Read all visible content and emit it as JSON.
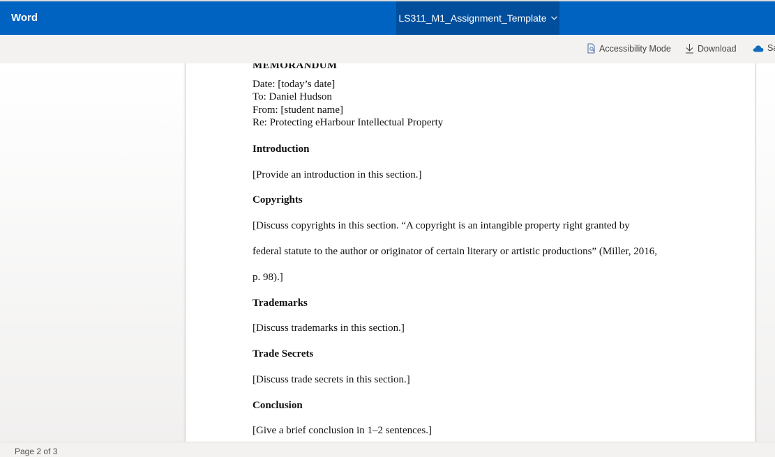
{
  "app": {
    "name": "Word",
    "document_title": "LS311_M1_Assignment_Template"
  },
  "commands": {
    "accessibility_mode": "Accessibility Mode",
    "download": "Download",
    "save": "Sa"
  },
  "document": {
    "memo_heading": "MEMORANDUM",
    "date_line": "Date: [today’s date]",
    "to_line": "To: Daniel Hudson",
    "from_line": "From: [student name]",
    "re_line": "Re: Protecting eHarbour Intellectual Property",
    "introduction_heading": "Introduction",
    "introduction_text": "[Provide an introduction in this section.]",
    "copyrights_heading": "Copyrights",
    "copyrights_text_1": "[Discuss copyrights in this section. “A copyright is an intangible property right granted by",
    "copyrights_text_2": "federal statute to the author or originator of certain literary or artistic productions” (Miller,  2016,",
    "copyrights_text_3": "p. 98).]",
    "trademarks_heading": "Trademarks",
    "trademarks_text": "[Discuss trademarks in this section.]",
    "trade_secrets_heading": "Trade Secrets",
    "trade_secrets_text": "[Discuss trade secrets in this section.]",
    "conclusion_heading": "Conclusion",
    "conclusion_text": "[Give a brief conclusion in 1–2 sentences.]"
  },
  "status": {
    "page_indicator": "Page 2 of 3"
  },
  "colors": {
    "brand_blue": "#0063c1",
    "title_highlight": "#004e9c",
    "onedrive_blue": "#0f6cbd"
  },
  "icons": [
    "chevron-down-icon",
    "accessibility-icon",
    "download-icon",
    "onedrive-cloud-icon"
  ]
}
